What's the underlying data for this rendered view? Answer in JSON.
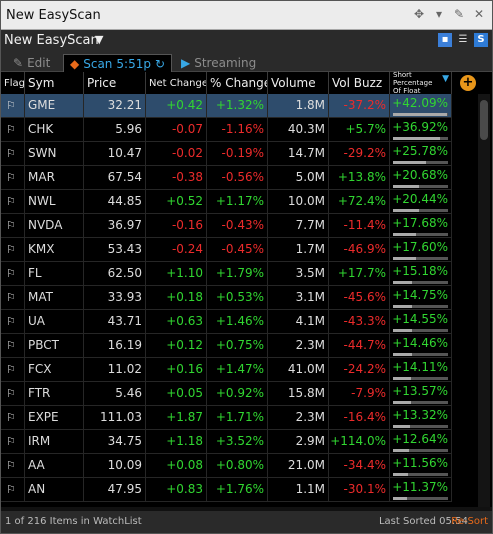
{
  "window": {
    "title": "New EasyScan"
  },
  "titlebar_icons": [
    "move-icon",
    "arrow-icon",
    "pin-icon",
    "close-icon"
  ],
  "header": {
    "name": "New EasyScan",
    "icons": [
      "save-icon",
      "list-icon",
      "s-icon"
    ]
  },
  "tabs": [
    {
      "label": "Edit",
      "icon": "edit-icon"
    },
    {
      "label": "Scan",
      "time": "5:51p",
      "icon": "refresh-icon"
    },
    {
      "label": "Streaming",
      "icon": "play-icon"
    }
  ],
  "columns": [
    "Flag",
    "Sym",
    "Price",
    "Net Change",
    "% Change",
    "Volume",
    "Vol Buzz",
    "Short Percentage Of Float"
  ],
  "rows": [
    {
      "sym": "GME",
      "price": "32.21",
      "net": "+0.42",
      "pct": "+1.32%",
      "vol": "1.8M",
      "buzz": "-37.2%",
      "spf": "+42.09%",
      "spf_fill": 0.98
    },
    {
      "sym": "CHK",
      "price": "5.96",
      "net": "-0.07",
      "pct": "-1.16%",
      "vol": "40.3M",
      "buzz": "+5.7%",
      "spf": "+36.92%",
      "spf_fill": 0.86
    },
    {
      "sym": "SWN",
      "price": "10.47",
      "net": "-0.02",
      "pct": "-0.19%",
      "vol": "14.7M",
      "buzz": "-29.2%",
      "spf": "+25.78%",
      "spf_fill": 0.6
    },
    {
      "sym": "MAR",
      "price": "67.54",
      "net": "-0.38",
      "pct": "-0.56%",
      "vol": "5.0M",
      "buzz": "+13.8%",
      "spf": "+20.68%",
      "spf_fill": 0.48
    },
    {
      "sym": "NWL",
      "price": "44.85",
      "net": "+0.52",
      "pct": "+1.17%",
      "vol": "10.0M",
      "buzz": "+72.4%",
      "spf": "+20.44%",
      "spf_fill": 0.47
    },
    {
      "sym": "NVDA",
      "price": "36.97",
      "net": "-0.16",
      "pct": "-0.43%",
      "vol": "7.7M",
      "buzz": "-11.4%",
      "spf": "+17.68%",
      "spf_fill": 0.41
    },
    {
      "sym": "KMX",
      "price": "53.43",
      "net": "-0.24",
      "pct": "-0.45%",
      "vol": "1.7M",
      "buzz": "-46.9%",
      "spf": "+17.60%",
      "spf_fill": 0.41
    },
    {
      "sym": "FL",
      "price": "62.50",
      "net": "+1.10",
      "pct": "+1.79%",
      "vol": "3.5M",
      "buzz": "+17.7%",
      "spf": "+15.18%",
      "spf_fill": 0.35
    },
    {
      "sym": "MAT",
      "price": "33.93",
      "net": "+0.18",
      "pct": "+0.53%",
      "vol": "3.1M",
      "buzz": "-45.6%",
      "spf": "+14.75%",
      "spf_fill": 0.34
    },
    {
      "sym": "UA",
      "price": "43.71",
      "net": "+0.63",
      "pct": "+1.46%",
      "vol": "4.1M",
      "buzz": "-43.3%",
      "spf": "+14.55%",
      "spf_fill": 0.34
    },
    {
      "sym": "PBCT",
      "price": "16.19",
      "net": "+0.12",
      "pct": "+0.75%",
      "vol": "2.3M",
      "buzz": "-44.7%",
      "spf": "+14.46%",
      "spf_fill": 0.34
    },
    {
      "sym": "FCX",
      "price": "11.02",
      "net": "+0.16",
      "pct": "+1.47%",
      "vol": "41.0M",
      "buzz": "-24.2%",
      "spf": "+14.11%",
      "spf_fill": 0.33
    },
    {
      "sym": "FTR",
      "price": "5.46",
      "net": "+0.05",
      "pct": "+0.92%",
      "vol": "15.8M",
      "buzz": "-7.9%",
      "spf": "+13.57%",
      "spf_fill": 0.32
    },
    {
      "sym": "EXPE",
      "price": "111.03",
      "net": "+1.87",
      "pct": "+1.71%",
      "vol": "2.3M",
      "buzz": "-16.4%",
      "spf": "+13.32%",
      "spf_fill": 0.31
    },
    {
      "sym": "IRM",
      "price": "34.75",
      "net": "+1.18",
      "pct": "+3.52%",
      "vol": "2.9M",
      "buzz": "+114.0%",
      "spf": "+12.64%",
      "spf_fill": 0.29
    },
    {
      "sym": "AA",
      "price": "10.09",
      "net": "+0.08",
      "pct": "+0.80%",
      "vol": "21.0M",
      "buzz": "-34.4%",
      "spf": "+11.56%",
      "spf_fill": 0.27
    },
    {
      "sym": "AN",
      "price": "47.95",
      "net": "+0.83",
      "pct": "+1.76%",
      "vol": "1.1M",
      "buzz": "-30.1%",
      "spf": "+11.37%",
      "spf_fill": 0.26
    }
  ],
  "status": {
    "left": "1 of 216 Items in WatchList",
    "sorted": "Last Sorted 05:54",
    "resort": "Re-Sort"
  },
  "colors": {
    "positive": "#31d631",
    "negative": "#ec2b2b",
    "selected_row": "#2e4c6c",
    "accent": "#38a8e6",
    "resort": "#e86a1a"
  }
}
